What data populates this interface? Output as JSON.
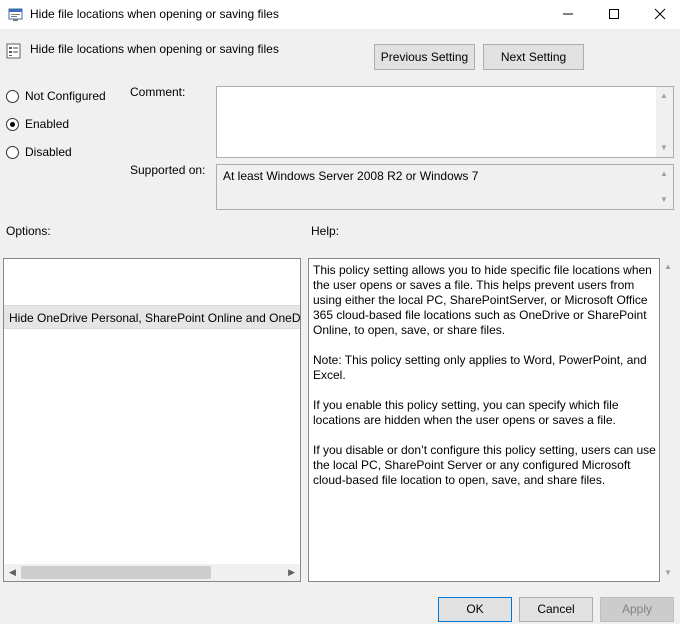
{
  "window": {
    "title": "Hide file locations when opening or saving files"
  },
  "header": {
    "title": "Hide file locations when opening or saving files",
    "prev_label": "Previous Setting",
    "next_label": "Next Setting"
  },
  "state": {
    "options": [
      {
        "label": "Not Configured",
        "selected": false
      },
      {
        "label": "Enabled",
        "selected": true
      },
      {
        "label": "Disabled",
        "selected": false
      }
    ]
  },
  "comment": {
    "label": "Comment:",
    "value": ""
  },
  "supported": {
    "label": "Supported on:",
    "value": "At least Windows Server 2008 R2 or Windows 7"
  },
  "options_panel": {
    "label": "Options:",
    "item": "Hide OneDrive Personal, SharePoint Online and OneDrive"
  },
  "help_panel": {
    "label": "Help:",
    "paragraphs": [
      "This policy setting allows you to hide specific file locations when the user opens or saves a file. This helps prevent users from using either the local PC, SharePointServer, or Microsoft Office 365 cloud-based file locations such as OneDrive or SharePoint Online, to open, save, or share files.",
      "Note: This policy setting only applies to Word, PowerPoint, and Excel.",
      "If you enable this policy setting, you can specify which file locations are hidden when the user opens or saves a file.",
      "If you disable or don’t configure this policy setting, users can use the local PC, SharePoint Server or any configured Microsoft cloud-based file location to open, save, and share files."
    ]
  },
  "footer": {
    "ok_label": "OK",
    "cancel_label": "Cancel",
    "apply_label": "Apply"
  },
  "colors": {
    "background": "#f0f0f0",
    "ok_border": "#0078d7",
    "disabled_text": "#838383"
  }
}
